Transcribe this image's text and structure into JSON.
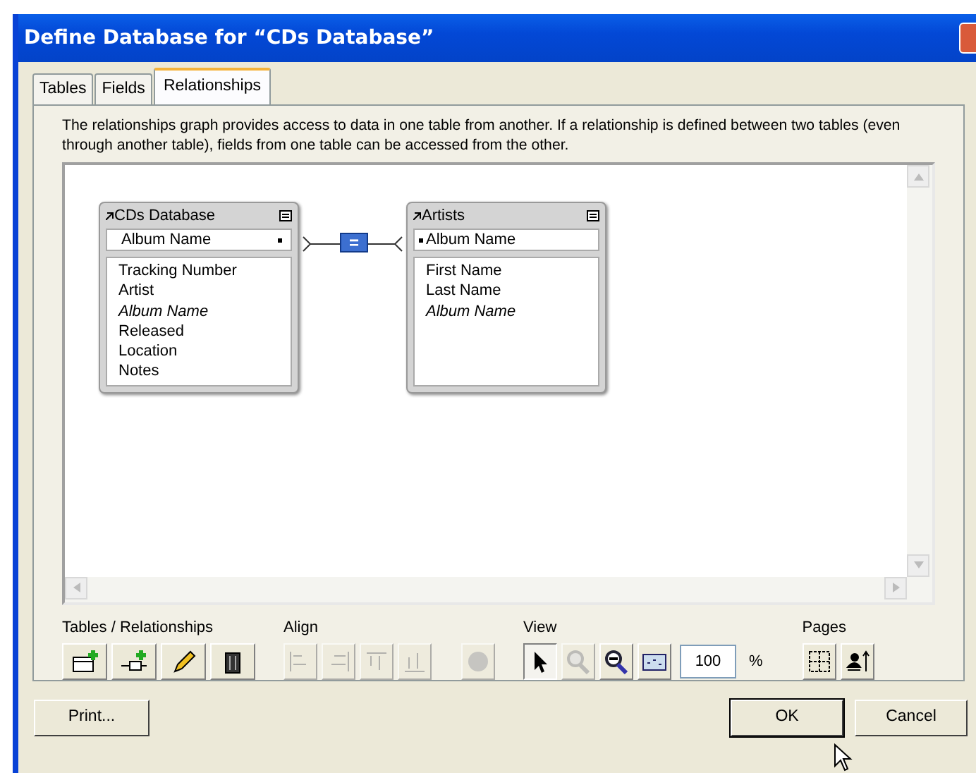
{
  "window": {
    "title": "Define Database for “CDs Database”"
  },
  "tabs": [
    {
      "label": "Tables",
      "selected": false
    },
    {
      "label": "Fields",
      "selected": false
    },
    {
      "label": "Relationships",
      "selected": true
    }
  ],
  "description": "The relationships graph provides access to data in one table from another. If a relationship is defined between two tables (even through another table), fields from one table can be accessed from the other.",
  "graph": {
    "tables": [
      {
        "name": "CDs Database",
        "match_field": "Album Name",
        "fields": [
          {
            "name": "Tracking Number",
            "italic": false
          },
          {
            "name": "Artist",
            "italic": false
          },
          {
            "name": "Album Name",
            "italic": true
          },
          {
            "name": "Released",
            "italic": false
          },
          {
            "name": "Location",
            "italic": false
          },
          {
            "name": "Notes",
            "italic": false
          }
        ]
      },
      {
        "name": "Artists",
        "match_field": "Album Name",
        "fields": [
          {
            "name": "First Name",
            "italic": false
          },
          {
            "name": "Last Name",
            "italic": false
          },
          {
            "name": "Album Name",
            "italic": true
          }
        ]
      }
    ],
    "relationship": {
      "operator": "="
    }
  },
  "toolbar": [
    {
      "label": "Tables / Relationships",
      "tools": [
        {
          "kind": "add-table",
          "disabled": false,
          "pressed": false
        },
        {
          "kind": "add-relationship",
          "disabled": false,
          "pressed": false
        },
        {
          "kind": "edit",
          "disabled": false,
          "pressed": false
        },
        {
          "kind": "delete",
          "disabled": false,
          "pressed": false
        }
      ]
    },
    {
      "label": "Align",
      "tools": [
        {
          "kind": "align-left",
          "disabled": true,
          "pressed": false
        },
        {
          "kind": "align-right",
          "disabled": true,
          "pressed": false
        },
        {
          "kind": "align-top",
          "disabled": true,
          "pressed": false
        },
        {
          "kind": "align-bottom",
          "disabled": true,
          "pressed": false
        },
        {
          "kind": "color",
          "disabled": true,
          "pressed": false
        }
      ]
    },
    {
      "label": "View",
      "tools": [
        {
          "kind": "pointer",
          "disabled": false,
          "pressed": true
        },
        {
          "kind": "zoom-in",
          "disabled": true,
          "pressed": false
        },
        {
          "kind": "zoom-out",
          "disabled": false,
          "pressed": false
        },
        {
          "kind": "fit",
          "disabled": false,
          "pressed": false
        }
      ],
      "zoom": "100",
      "unit": "%"
    },
    {
      "label": "Pages",
      "tools": [
        {
          "kind": "page-breaks",
          "disabled": false,
          "pressed": false
        },
        {
          "kind": "page-setup",
          "disabled": false,
          "pressed": false
        }
      ]
    }
  ],
  "buttons": [
    {
      "label": "Print...",
      "default": false
    },
    {
      "label": "OK",
      "default": true
    },
    {
      "label": "Cancel",
      "default": false
    }
  ]
}
